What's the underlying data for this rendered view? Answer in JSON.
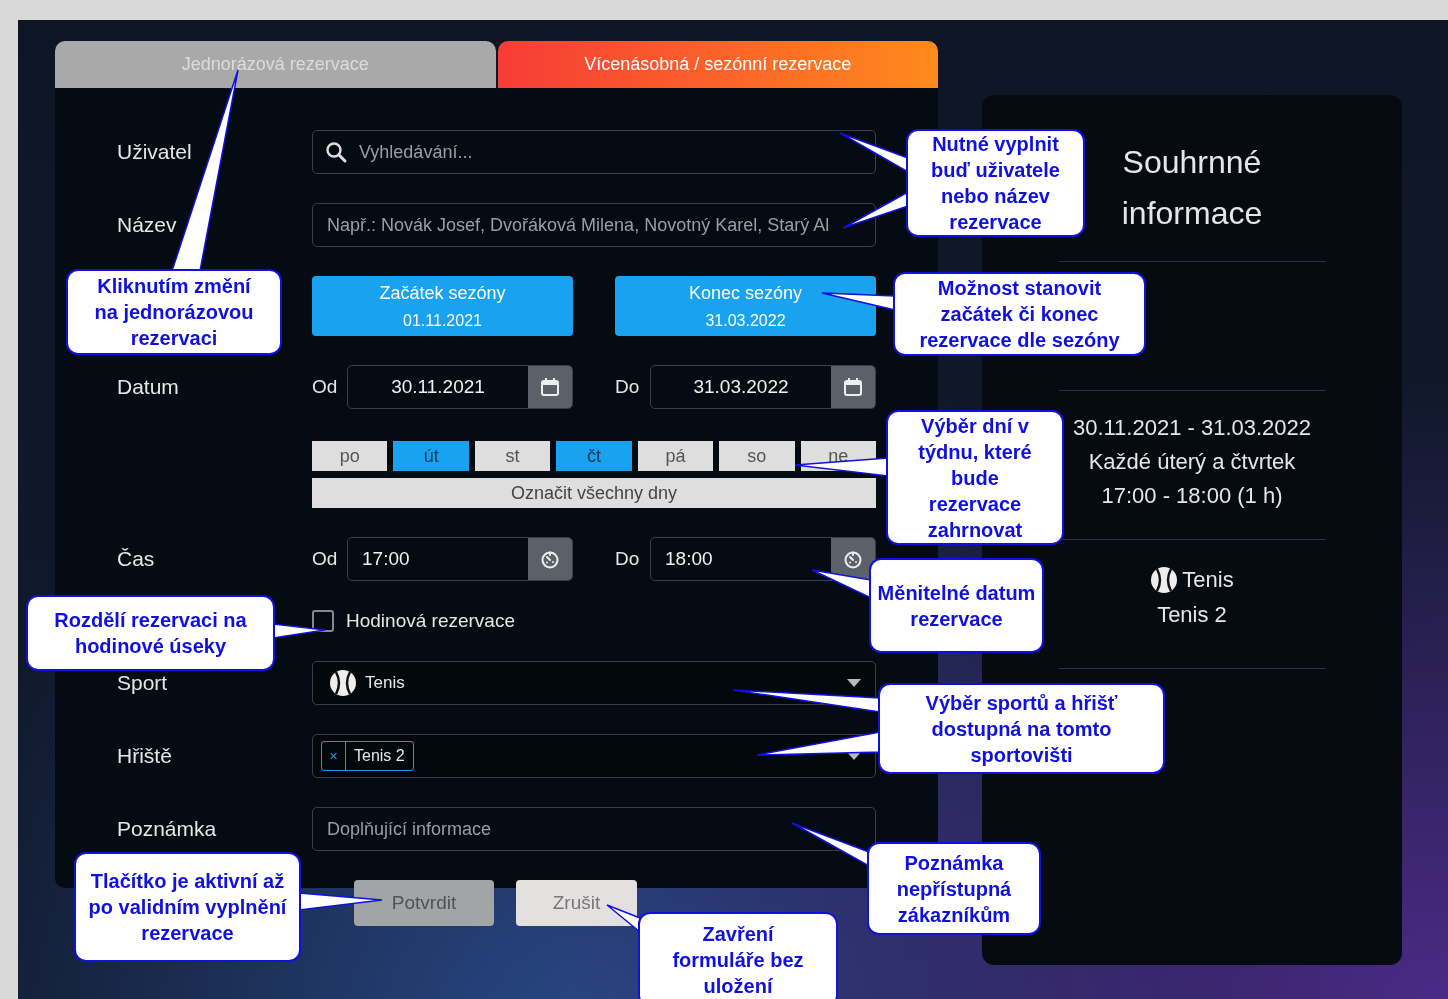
{
  "tabs": [
    {
      "label": "Jednorázová rezervace",
      "selected": false
    },
    {
      "label": "Vícenásobná / sezónní rezervace",
      "selected": true
    }
  ],
  "form": {
    "user": {
      "label": "Uživatel",
      "placeholder": "Vyhledávání..."
    },
    "name": {
      "label": "Název",
      "placeholder": "Např.: Novák Josef, Dvořáková Milena, Novotný Karel, Starý Al"
    },
    "seasons": [
      {
        "label": "Začátek sezóny",
        "date": "01.11.2021"
      },
      {
        "label": "Konec sezóny",
        "date": "31.03.2022"
      }
    ],
    "date": {
      "label": "Datum",
      "from_label": "Od",
      "from": "30.11.2021",
      "to_label": "Do",
      "to": "31.03.2022"
    },
    "days": [
      {
        "label": "po",
        "selected": false
      },
      {
        "label": "út",
        "selected": true
      },
      {
        "label": "st",
        "selected": false
      },
      {
        "label": "čt",
        "selected": true
      },
      {
        "label": "pá",
        "selected": false
      },
      {
        "label": "so",
        "selected": false
      },
      {
        "label": "ne",
        "selected": false
      }
    ],
    "select_all": "Označit všechny dny",
    "time": {
      "label": "Čas",
      "from_label": "Od",
      "from": "17:00",
      "to_label": "Do",
      "to": "18:00"
    },
    "hourly": {
      "label": "Hodinová rezervace",
      "checked": false
    },
    "sport": {
      "label": "Sport",
      "value": "Tenis"
    },
    "court": {
      "label": "Hřiště",
      "tags": [
        {
          "remove": "×",
          "label": "Tenis 2"
        }
      ]
    },
    "note": {
      "label": "Poznámka",
      "placeholder": "Doplňující informace"
    },
    "buttons": [
      {
        "label": "Potvrdit",
        "disabled": true
      },
      {
        "label": "Zrušit",
        "disabled": false
      }
    ]
  },
  "summary": {
    "title": "Souhrnné informace",
    "period": "30.11.2021 - 31.03.2022",
    "days": "Každé úterý a čtvrtek",
    "time": "17:00 - 18:00 (1 h)",
    "sport": "Tenis",
    "court": "Tenis 2"
  },
  "callouts": [
    "Kliknutím změní na jednorázovou rezervaci",
    "Nutné vyplnit buď uživatele nebo název rezervace",
    "Možnost stanovit začátek či konec rezervace dle sezóny",
    "Výběr dní v týdnu, které bude rezervace zahrnovat",
    "Měnitelné datum rezervace",
    "Rozdělí rezervaci na hodinové úseky",
    "Výběr sportů a hřišť dostupná na tomto sportovišti",
    "Poznámka nepřístupná zákazníkům",
    "Tlačítko je aktivní až po validním vyplnění rezervace",
    "Zavření formuláře bez uložení"
  ]
}
